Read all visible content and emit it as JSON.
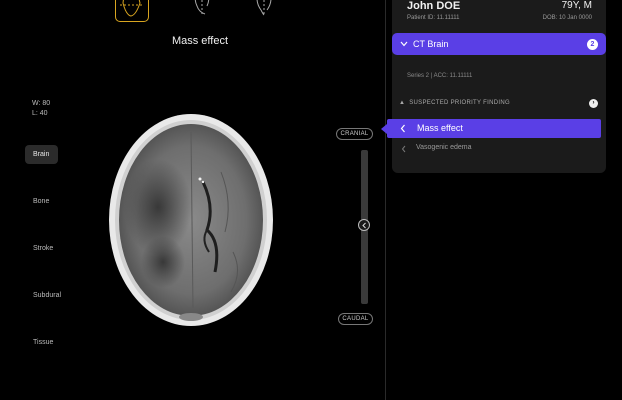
{
  "viewer": {
    "title": "Mass effect",
    "window_level": {
      "width": "W: 80",
      "level": "L: 40"
    },
    "presets": [
      "Brain",
      "Bone",
      "Stroke",
      "Subdural",
      "Tissue"
    ],
    "active_preset": "Brain",
    "orientation": {
      "top": "CRANIAL",
      "bottom": "CAUDAL"
    },
    "view_thumbnails": [
      "axial-head-icon",
      "sagittal-head-icon",
      "coronal-head-icon"
    ]
  },
  "patient": {
    "name": "John DOE",
    "age_sex": "79Y, M",
    "id": "Patient ID: 11.11111",
    "dob": "DOB: 10 Jan 0000"
  },
  "study": {
    "label": "CT Brain",
    "count": "2",
    "series": "Series 2 | ACC: 11.11111",
    "finding_header": "SUSPECTED PRIORITY FINDING",
    "findings": [
      {
        "label": "Mass effect",
        "active": true
      },
      {
        "label": "Vasogenic edema",
        "active": false
      }
    ]
  },
  "colors": {
    "accent": "#5a3fe6",
    "thumb_active": "#d8a520"
  }
}
